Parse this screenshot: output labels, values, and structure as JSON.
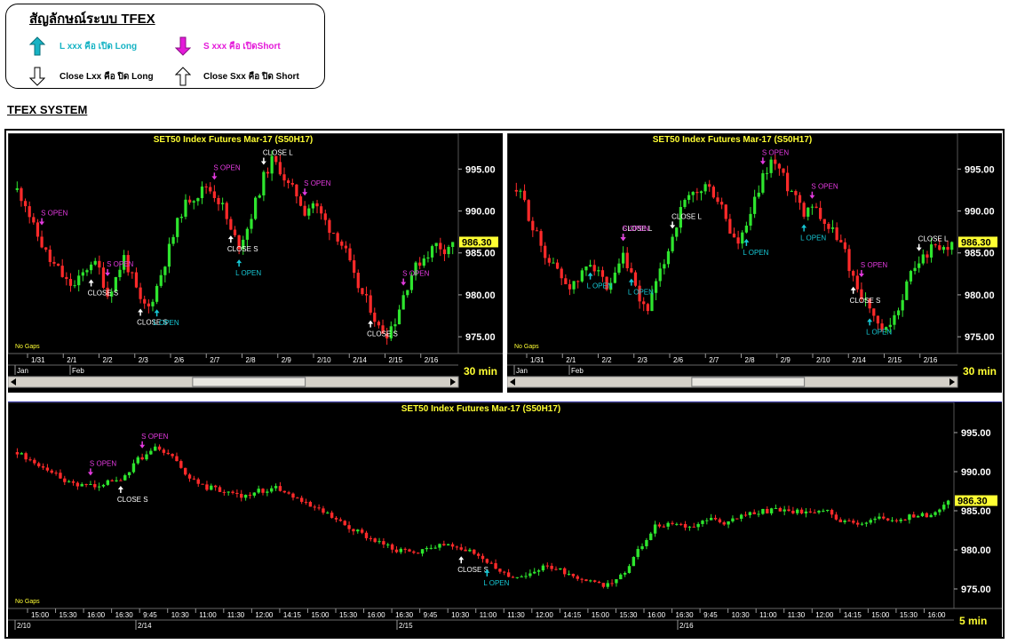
{
  "legend": {
    "title": "สัญลักษณ์ระบบ TFEX",
    "items": [
      {
        "arrow": "filled-up",
        "color": "#16b3c4",
        "text": "L xxx คือ เปิด Long"
      },
      {
        "arrow": "filled-down",
        "color": "#e41ad9",
        "text": "S xxx คือ เปิดShort"
      },
      {
        "arrow": "hollow-down",
        "color": "#000000",
        "text": "Close Lxx คือ ปิด Long"
      },
      {
        "arrow": "hollow-up",
        "color": "#000000",
        "text": "Close Sxx คือ ปิด Short"
      }
    ]
  },
  "system_title": "TFEX SYSTEM",
  "colors": {
    "up": "#2ee52e",
    "down": "#ff2a2a",
    "open_long": "#16c7d4",
    "open_short": "#e43ae0",
    "close": "#ffffff",
    "title": "#ffff33",
    "price_box": "#ffff33"
  },
  "charts": [
    {
      "id": "top-left",
      "title": "SET50  Index  Futures  Mar-17  (S50H17)",
      "price_label": "986.30",
      "y_ticks": [
        "995.00",
        "990.00",
        "985.00",
        "980.00",
        "975.00"
      ],
      "ylim": [
        973.0,
        998.0
      ],
      "x_ticks": [
        "1/31",
        "2/1",
        "2/2",
        "2/3",
        "2/6",
        "2/7",
        "2/8",
        "2/9",
        "2/10",
        "2/14",
        "2/15",
        "2/16"
      ],
      "month_labels": [
        "Jan",
        "Feb"
      ],
      "gaps_label": "No Gaps",
      "timeframe": "30  min",
      "signals": [
        {
          "type": "short-open",
          "text": "S  OPEN",
          "bar": 3
        },
        {
          "type": "short-open",
          "text": "S  OPEN",
          "bar": 11
        },
        {
          "type": "close-short",
          "text": "CLOSE  S",
          "bar": 9
        },
        {
          "type": "close-short",
          "text": "CLOSE  S",
          "bar": 15
        },
        {
          "type": "long-open",
          "text": "L  OPEN",
          "bar": 17
        },
        {
          "type": "short-open",
          "text": "S  OPEN",
          "bar": 24
        },
        {
          "type": "long-open",
          "text": "L  OPEN",
          "bar": 27
        },
        {
          "type": "close-short",
          "text": "CLOSE  S",
          "bar": 26
        },
        {
          "type": "close-long",
          "text": "CLOSE  L",
          "bar": 30
        },
        {
          "type": "short-open",
          "text": "S  OPEN",
          "bar": 35
        },
        {
          "type": "close-short",
          "text": "CLOSE  S",
          "bar": 43
        },
        {
          "type": "short-open",
          "text": "S  OPEN",
          "bar": 47
        }
      ]
    },
    {
      "id": "top-right",
      "title": "SET50  Index  Futures  Mar-17  (S50H17)",
      "price_label": "986.30",
      "y_ticks": [
        "995.00",
        "990.00",
        "985.00",
        "980.00",
        "975.00"
      ],
      "ylim": [
        973.0,
        998.0
      ],
      "x_ticks": [
        "1/31",
        "2/1",
        "2/2",
        "2/3",
        "2/6",
        "2/7",
        "2/8",
        "2/9",
        "2/10",
        "2/14",
        "2/15",
        "2/16"
      ],
      "month_labels": [
        "Jan",
        "Feb"
      ],
      "gaps_label": "No Gaps",
      "timeframe": "30  min",
      "signals": [
        {
          "type": "long-open",
          "text": "L  OPEN",
          "bar": 9
        },
        {
          "type": "close-long",
          "text": "CLOSE  L",
          "bar": 13
        },
        {
          "type": "short-open",
          "text": "S  OPEN",
          "bar": 13
        },
        {
          "type": "long-open",
          "text": "L  OPEN",
          "bar": 14
        },
        {
          "type": "close-long",
          "text": "CLOSE  L",
          "bar": 19
        },
        {
          "type": "long-open",
          "text": "L  OPEN",
          "bar": 28
        },
        {
          "type": "short-open",
          "text": "S  OPEN",
          "bar": 30
        },
        {
          "type": "short-open",
          "text": "S  OPEN",
          "bar": 36
        },
        {
          "type": "long-open",
          "text": "L  OPEN",
          "bar": 35
        },
        {
          "type": "short-open",
          "text": "S  OPEN",
          "bar": 42
        },
        {
          "type": "close-short",
          "text": "CLOSE  S",
          "bar": 41
        },
        {
          "type": "long-open",
          "text": "L  OPEN",
          "bar": 43
        },
        {
          "type": "close-long",
          "text": "CLOSE  L",
          "bar": 49
        }
      ]
    },
    {
      "id": "bottom",
      "title": "SET50  Index  Futures  Mar-17  (S50H17)",
      "price_label": "986.30",
      "y_ticks": [
        "995.00",
        "990.00",
        "985.00",
        "980.00",
        "975.00"
      ],
      "ylim": [
        972.5,
        997.5
      ],
      "x_ticks": [
        "15:00",
        "15:30",
        "16:00",
        "16:30",
        "9:45",
        "10:30",
        "11:00",
        "11:30",
        "12:00",
        "14:15",
        "15:00",
        "15:30",
        "16:00",
        "16:30",
        "9:45",
        "10:30",
        "11:00",
        "11:30",
        "12:00",
        "14:15",
        "15:00",
        "15:30",
        "16:00",
        "16:30",
        "9:45",
        "10:30",
        "11:00",
        "11:30",
        "12:00",
        "14:15",
        "15:00",
        "15:30",
        "16:00"
      ],
      "month_labels": [
        "2/10",
        "2/14",
        "2/15",
        "2/16"
      ],
      "gaps_label": "No Gaps",
      "timeframe": "5  min",
      "signals": [
        {
          "type": "short-open",
          "text": "S  OPEN",
          "bar": 14
        },
        {
          "type": "close-short",
          "text": "CLOSE  S",
          "bar": 20
        },
        {
          "type": "short-open",
          "text": "S  OPEN",
          "bar": 24
        },
        {
          "type": "close-short",
          "text": "CLOSE  S",
          "bar": 86
        },
        {
          "type": "long-open",
          "text": "L  OPEN",
          "bar": 91
        }
      ]
    }
  ],
  "chart_data": [
    {
      "type": "candlestick",
      "title": "SET50  Index  Futures  Mar-17  (S50H17)",
      "ylim": [
        973,
        998
      ],
      "x": [
        "1/31",
        "2/1",
        "2/2",
        "2/3",
        "2/6",
        "2/7",
        "2/8",
        "2/9",
        "2/10",
        "2/14",
        "2/15",
        "2/16"
      ],
      "close_path": [
        992.5,
        991,
        988,
        986,
        984,
        983,
        981.5,
        981,
        982.5,
        984,
        983,
        980,
        982,
        984.5,
        982,
        979,
        978.5,
        981,
        984,
        987,
        990,
        991.5,
        992,
        993,
        992,
        990.5,
        987.5,
        986,
        988,
        991,
        994,
        996,
        995,
        993,
        992,
        990,
        991,
        989.5,
        988,
        987,
        985,
        982,
        980,
        978.5,
        976,
        975.5,
        977,
        980,
        982.5,
        984,
        985,
        986,
        985.5,
        986.3
      ],
      "last": 986.3
    },
    {
      "type": "candlestick",
      "title": "SET50  Index  Futures  Mar-17  (S50H17)",
      "ylim": [
        973,
        998
      ],
      "x": [
        "1/31",
        "2/1",
        "2/2",
        "2/3",
        "2/6",
        "2/7",
        "2/8",
        "2/9",
        "2/10",
        "2/14",
        "2/15",
        "2/16"
      ],
      "close_path": [
        992.5,
        991,
        988,
        986,
        984,
        983,
        981.5,
        981,
        982.5,
        984,
        983,
        980,
        982,
        984.5,
        982,
        979,
        978.5,
        981,
        984,
        987,
        990,
        991.5,
        992,
        993,
        992,
        990.5,
        987.5,
        986,
        988,
        991,
        994,
        996,
        995,
        993,
        992,
        990,
        991,
        989.5,
        988,
        987,
        985,
        982,
        980,
        978.5,
        976,
        975.5,
        977,
        980,
        982.5,
        984,
        985,
        986,
        985.5,
        986.3
      ],
      "last": 986.3
    },
    {
      "type": "candlestick",
      "title": "SET50  Index  Futures  Mar-17  (S50H17)",
      "ylim": [
        972.5,
        997.5
      ],
      "x": [
        "15:00",
        "15:30",
        "16:00",
        "16:30",
        "9:45",
        "10:30",
        "11:00",
        "11:30",
        "12:00",
        "14:15",
        "15:00",
        "15:30",
        "16:00",
        "16:30",
        "9:45",
        "10:30",
        "11:00",
        "11:30",
        "12:00",
        "14:15",
        "15:00",
        "15:30",
        "16:00",
        "16:30",
        "9:45",
        "10:30",
        "11:00",
        "11:30",
        "12:00",
        "14:15",
        "15:00",
        "15:30",
        "16:00"
      ],
      "close_path": [
        992.5,
        991,
        990,
        988.5,
        988,
        988.5,
        989,
        991.5,
        993,
        992,
        989,
        988,
        987.5,
        987,
        987.5,
        988,
        987,
        985.5,
        984.5,
        983,
        982,
        981,
        980,
        979.5,
        980.5,
        981,
        980,
        979,
        977,
        976.5,
        977.5,
        977.8,
        977,
        976,
        975.5,
        976.5,
        980,
        983,
        983.5,
        983,
        984,
        983.5,
        984.2,
        984.8,
        985.2,
        985,
        984.5,
        984.8,
        983.5,
        983.5,
        984,
        983.8,
        984.3,
        984.5,
        986.3
      ],
      "last": 986.3
    }
  ]
}
